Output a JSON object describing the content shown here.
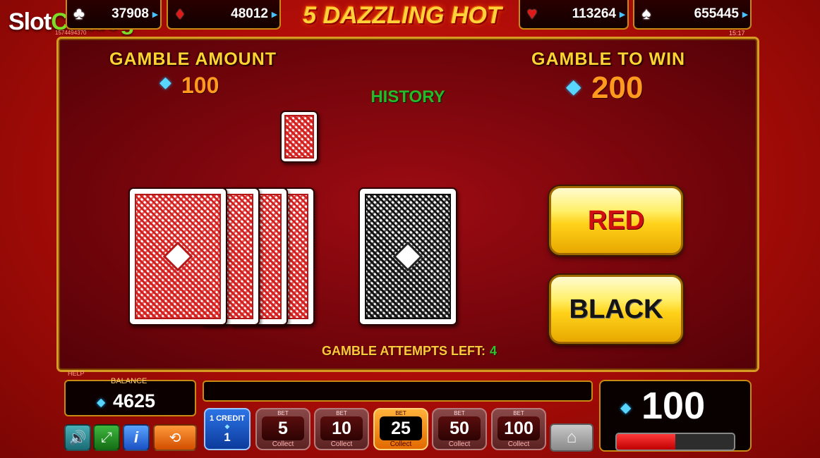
{
  "brand": {
    "part1": "Slot",
    "part2": "Catalog",
    "sub": "1574494370"
  },
  "clock": "15:17",
  "game_title": "5 DAZZLING HOT",
  "jackpots": [
    {
      "suit": "clubs",
      "value": "37908"
    },
    {
      "suit": "diamonds",
      "value": "48012"
    },
    {
      "suit": "hearts",
      "value": "113264"
    },
    {
      "suit": "spades",
      "value": "655445"
    }
  ],
  "gamble": {
    "amount_label": "GAMBLE AMOUNT",
    "amount_value": "100",
    "to_win_label": "GAMBLE TO WIN",
    "to_win_value": "200",
    "history_label": "HISTORY",
    "attempts_label": "GAMBLE ATTEMPTS LEFT:",
    "attempts_value": "4",
    "red_label": "RED",
    "black_label": "BLACK"
  },
  "bottom": {
    "help_label": "HELP",
    "balance_label": "BALANCE",
    "balance_value": "4625",
    "credit_label": "1 CREDIT",
    "credit_value": "1",
    "bet_label": "BET",
    "collect_label": "Collect",
    "bets": [
      "5",
      "10",
      "25",
      "50",
      "100"
    ],
    "selected_bet": "25",
    "win_value": "100",
    "meter_fill": 0.5
  },
  "colors": {
    "accent_gold": "#d79a22",
    "panel": "#6b040a",
    "gem": "#49c3ff"
  }
}
